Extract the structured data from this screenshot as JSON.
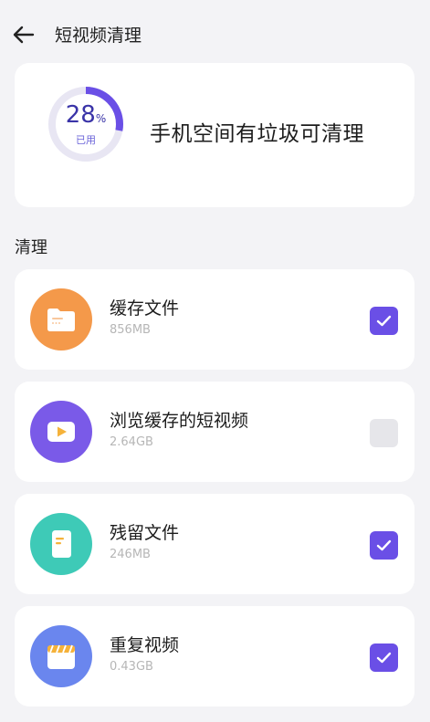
{
  "header": {
    "title": "短视频清理",
    "back_icon": "arrow-left-icon"
  },
  "usage": {
    "percent_value": "28",
    "percent_unit": "%",
    "used_label": "已用",
    "percent": 28,
    "message": "手机空间有垃圾可清理",
    "ring_color": "#6a4fe6",
    "track_color": "#e8e6f3"
  },
  "section": {
    "label": "清理"
  },
  "items": [
    {
      "name": "缓存文件",
      "size": "856MB",
      "checked": true,
      "icon": "folder-icon",
      "color": "#f4994a"
    },
    {
      "name": "浏览缓存的短视频",
      "size": "2.64GB",
      "checked": false,
      "icon": "video-icon",
      "color": "#7a5ae8"
    },
    {
      "name": "残留文件",
      "size": "246MB",
      "checked": true,
      "icon": "document-icon",
      "color": "#3ecab7"
    },
    {
      "name": "重复视频",
      "size": "0.43GB",
      "checked": true,
      "icon": "clapperboard-icon",
      "color": "#6a86ee"
    }
  ],
  "colors": {
    "accent": "#6a4fe6",
    "background": "#f3f3f6",
    "card": "#ffffff"
  }
}
